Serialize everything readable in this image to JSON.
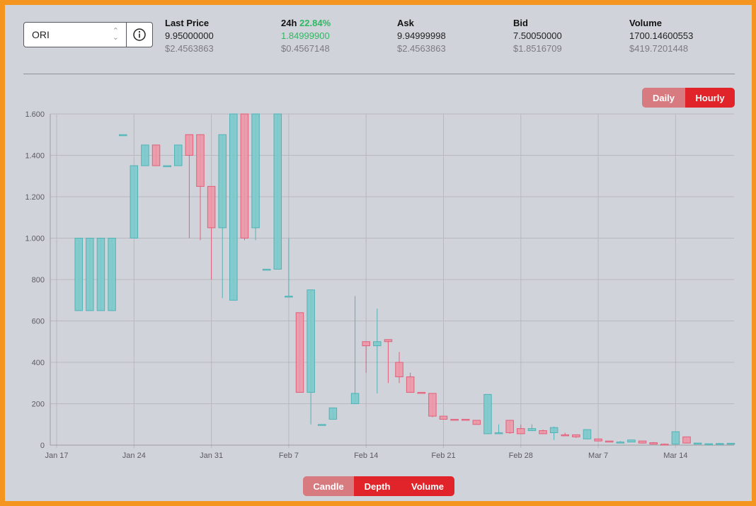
{
  "market": {
    "symbol": "ORI"
  },
  "stats": [
    {
      "label": "Last Price",
      "label_extra": "",
      "value": "9.95000000",
      "value_usd": "$2.4563863"
    },
    {
      "label": "24h",
      "label_extra": "22.84%",
      "value": "1.84999900",
      "value_usd": "$0.4567148"
    },
    {
      "label": "Ask",
      "label_extra": "",
      "value": "9.94999998",
      "value_usd": "$2.4563863"
    },
    {
      "label": "Bid",
      "label_extra": "",
      "value": "7.50050000",
      "value_usd": "$1.8516709"
    },
    {
      "label": "Volume",
      "label_extra": "",
      "value": "1700.14600553",
      "value_usd": "$419.7201448"
    }
  ],
  "interval_buttons": {
    "daily": "Daily",
    "hourly": "Hourly"
  },
  "view_buttons": {
    "candle": "Candle",
    "depth": "Depth",
    "volume": "Volume"
  },
  "colors": {
    "up": "#7ccacb",
    "up_border": "#4fb3b6",
    "down": "#ec97a6",
    "down_border": "#e0607a",
    "accent": "#e0242a",
    "positive": "#2fb862"
  },
  "chart_data": {
    "type": "candlestick",
    "title": "",
    "xlabel": "",
    "ylabel": "",
    "ylim": [
      0,
      1.6
    ],
    "x_ticks": [
      "Jan 17",
      "Jan 24",
      "Jan 31",
      "Feb 7",
      "Feb 14",
      "Feb 21",
      "Feb 28",
      "Mar 7",
      "Mar 14"
    ],
    "y_ticks": [
      "0",
      "200",
      "400",
      "600",
      "800",
      "1.000",
      "1.200",
      "1.400",
      "1.600"
    ],
    "y_tick_values": [
      0,
      0.2,
      0.4,
      0.6,
      0.8,
      1.0,
      1.2,
      1.4,
      1.6
    ],
    "grid": true,
    "candles": [
      {
        "date": "Jan 19",
        "open": 0.65,
        "high": 1.0,
        "low": 0.65,
        "close": 1.0
      },
      {
        "date": "Jan 20",
        "open": 0.65,
        "high": 1.0,
        "low": 0.65,
        "close": 1.0
      },
      {
        "date": "Jan 21",
        "open": 0.65,
        "high": 1.0,
        "low": 0.65,
        "close": 1.0
      },
      {
        "date": "Jan 22",
        "open": 0.65,
        "high": 1.0,
        "low": 0.65,
        "close": 1.0
      },
      {
        "date": "Jan 23",
        "open": 1.5,
        "high": 1.5,
        "low": 1.5,
        "close": 1.5
      },
      {
        "date": "Jan 24",
        "open": 1.0,
        "high": 1.35,
        "low": 1.0,
        "close": 1.35
      },
      {
        "date": "Jan 25",
        "open": 1.35,
        "high": 1.45,
        "low": 1.35,
        "close": 1.45
      },
      {
        "date": "Jan 26",
        "open": 1.45,
        "high": 1.45,
        "low": 1.35,
        "close": 1.35
      },
      {
        "date": "Jan 27",
        "open": 1.35,
        "high": 1.35,
        "low": 1.35,
        "close": 1.35
      },
      {
        "date": "Jan 28",
        "open": 1.35,
        "high": 1.45,
        "low": 1.35,
        "close": 1.45
      },
      {
        "date": "Jan 29",
        "open": 1.5,
        "high": 1.5,
        "low": 1.0,
        "close": 1.4
      },
      {
        "date": "Jan 30",
        "open": 1.5,
        "high": 1.5,
        "low": 0.99,
        "close": 1.25
      },
      {
        "date": "Jan 31",
        "open": 1.25,
        "high": 1.25,
        "low": 0.8,
        "close": 1.05
      },
      {
        "date": "Feb 1",
        "open": 1.05,
        "high": 1.5,
        "low": 0.71,
        "close": 1.5
      },
      {
        "date": "Feb 2",
        "open": 0.7,
        "high": 1.6,
        "low": 0.7,
        "close": 1.6
      },
      {
        "date": "Feb 3",
        "open": 1.6,
        "high": 1.6,
        "low": 0.99,
        "close": 1.0
      },
      {
        "date": "Feb 4",
        "open": 1.05,
        "high": 1.6,
        "low": 0.99,
        "close": 1.6
      },
      {
        "date": "Feb 5",
        "open": 0.85,
        "high": 0.85,
        "low": 0.85,
        "close": 0.85
      },
      {
        "date": "Feb 6",
        "open": 0.85,
        "high": 1.6,
        "low": 0.85,
        "close": 1.6
      },
      {
        "date": "Feb 7",
        "open": 0.72,
        "high": 1.0,
        "low": 0.72,
        "close": 0.72
      },
      {
        "date": "Feb 8",
        "open": 0.64,
        "high": 0.64,
        "low": 0.255,
        "close": 0.255
      },
      {
        "date": "Feb 9",
        "open": 0.255,
        "high": 0.75,
        "low": 0.1,
        "close": 0.75
      },
      {
        "date": "Feb 10",
        "open": 0.1,
        "high": 0.1,
        "low": 0.1,
        "close": 0.1
      },
      {
        "date": "Feb 11",
        "open": 0.125,
        "high": 0.18,
        "low": 0.125,
        "close": 0.18
      },
      {
        "date": "Feb 13",
        "open": 0.2,
        "high": 0.72,
        "low": 0.2,
        "close": 0.25
      },
      {
        "date": "Feb 14",
        "open": 0.5,
        "high": 0.5,
        "low": 0.35,
        "close": 0.48
      },
      {
        "date": "Feb 15",
        "open": 0.48,
        "high": 0.66,
        "low": 0.25,
        "close": 0.5
      },
      {
        "date": "Feb 16",
        "open": 0.51,
        "high": 0.51,
        "low": 0.3,
        "close": 0.5
      },
      {
        "date": "Feb 17",
        "open": 0.4,
        "high": 0.45,
        "low": 0.3,
        "close": 0.33
      },
      {
        "date": "Feb 18",
        "open": 0.33,
        "high": 0.35,
        "low": 0.255,
        "close": 0.255
      },
      {
        "date": "Feb 19",
        "open": 0.255,
        "high": 0.255,
        "low": 0.25,
        "close": 0.25
      },
      {
        "date": "Feb 20",
        "open": 0.25,
        "high": 0.25,
        "low": 0.135,
        "close": 0.14
      },
      {
        "date": "Feb 21",
        "open": 0.14,
        "high": 0.14,
        "low": 0.125,
        "close": 0.125
      },
      {
        "date": "Feb 22",
        "open": 0.125,
        "high": 0.125,
        "low": 0.12,
        "close": 0.12
      },
      {
        "date": "Feb 23",
        "open": 0.125,
        "high": 0.125,
        "low": 0.12,
        "close": 0.12
      },
      {
        "date": "Feb 24",
        "open": 0.12,
        "high": 0.12,
        "low": 0.1,
        "close": 0.1
      },
      {
        "date": "Feb 25",
        "open": 0.055,
        "high": 0.245,
        "low": 0.055,
        "close": 0.245
      },
      {
        "date": "Feb 26",
        "open": 0.055,
        "high": 0.1,
        "low": 0.055,
        "close": 0.06
      },
      {
        "date": "Feb 27",
        "open": 0.12,
        "high": 0.12,
        "low": 0.055,
        "close": 0.06
      },
      {
        "date": "Feb 28",
        "open": 0.08,
        "high": 0.1,
        "low": 0.055,
        "close": 0.055
      },
      {
        "date": "Mar 1",
        "open": 0.07,
        "high": 0.1,
        "low": 0.07,
        "close": 0.08
      },
      {
        "date": "Mar 2",
        "open": 0.07,
        "high": 0.075,
        "low": 0.055,
        "close": 0.055
      },
      {
        "date": "Mar 3",
        "open": 0.06,
        "high": 0.09,
        "low": 0.025,
        "close": 0.085
      },
      {
        "date": "Mar 4",
        "open": 0.05,
        "high": 0.06,
        "low": 0.045,
        "close": 0.045
      },
      {
        "date": "Mar 5",
        "open": 0.05,
        "high": 0.05,
        "low": 0.035,
        "close": 0.04
      },
      {
        "date": "Mar 6",
        "open": 0.03,
        "high": 0.075,
        "low": 0.03,
        "close": 0.075
      },
      {
        "date": "Mar 7",
        "open": 0.03,
        "high": 0.03,
        "low": 0.02,
        "close": 0.02
      },
      {
        "date": "Mar 8",
        "open": 0.02,
        "high": 0.02,
        "low": 0.015,
        "close": 0.015
      },
      {
        "date": "Mar 9",
        "open": 0.015,
        "high": 0.02,
        "low": 0.01,
        "close": 0.015
      },
      {
        "date": "Mar 10",
        "open": 0.015,
        "high": 0.025,
        "low": 0.015,
        "close": 0.025
      },
      {
        "date": "Mar 11",
        "open": 0.02,
        "high": 0.02,
        "low": 0.01,
        "close": 0.01
      },
      {
        "date": "Mar 12",
        "open": 0.012,
        "high": 0.015,
        "low": 0.005,
        "close": 0.005
      },
      {
        "date": "Mar 13",
        "open": 0.005,
        "high": 0.008,
        "low": 0.003,
        "close": 0.004
      },
      {
        "date": "Mar 14",
        "open": 0.005,
        "high": 0.065,
        "low": 0.005,
        "close": 0.065
      },
      {
        "date": "Mar 15",
        "open": 0.04,
        "high": 0.04,
        "low": 0.01,
        "close": 0.01
      },
      {
        "date": "Mar 16",
        "open": 0.008,
        "high": 0.01,
        "low": 0.005,
        "close": 0.01
      },
      {
        "date": "Mar 17",
        "open": 0.006,
        "high": 0.008,
        "low": 0.005,
        "close": 0.007
      },
      {
        "date": "Mar 18",
        "open": 0.007,
        "high": 0.01,
        "low": 0.005,
        "close": 0.008
      },
      {
        "date": "Mar 19",
        "open": 0.008,
        "high": 0.01,
        "low": 0.006,
        "close": 0.009
      }
    ]
  }
}
